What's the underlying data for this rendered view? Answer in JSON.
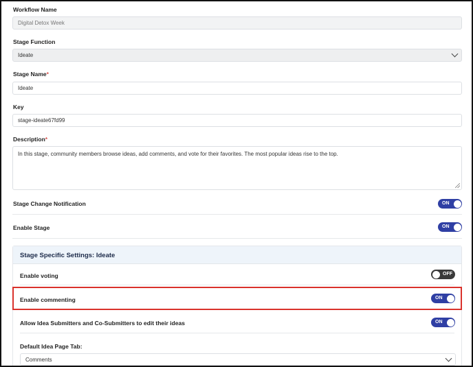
{
  "workflow_name": {
    "label": "Workflow Name",
    "value": "Digital Detox Week"
  },
  "stage_function": {
    "label": "Stage Function",
    "value": "Ideate"
  },
  "stage_name": {
    "label": "Stage Name",
    "required_mark": "*",
    "value": "Ideate"
  },
  "key": {
    "label": "Key",
    "value": "stage-ideate67fd99"
  },
  "description": {
    "label": "Description",
    "required_mark": "*",
    "value": "In this stage, community members browse ideas, add comments, and vote for their favorites.  The most popular ideas rise to the top."
  },
  "stage_change_notification": {
    "label": "Stage Change Notification",
    "toggle": "ON"
  },
  "enable_stage": {
    "label": "Enable Stage",
    "toggle": "ON"
  },
  "stage_settings": {
    "title": "Stage Specific Settings: Ideate",
    "enable_voting": {
      "label": "Enable voting",
      "toggle": "OFF"
    },
    "enable_commenting": {
      "label": "Enable commenting",
      "toggle": "ON"
    },
    "allow_edit": {
      "label": "Allow Idea Submitters and Co-Submitters to edit their ideas",
      "toggle": "ON"
    },
    "default_tab": {
      "label": "Default Idea Page Tab:",
      "value": "Comments"
    }
  },
  "colors": {
    "toggle_on": "#2f3fa4",
    "toggle_off": "#3a3a3a",
    "highlight": "#d9312b",
    "section_header": "#eef4fa"
  }
}
